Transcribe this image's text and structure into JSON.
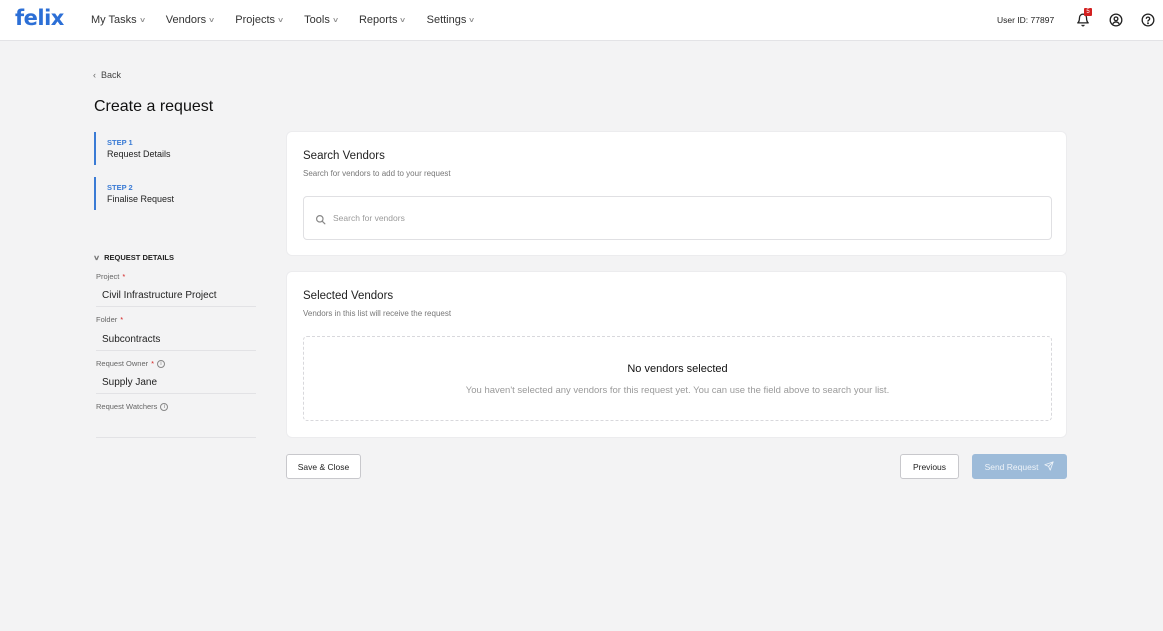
{
  "app": {
    "logo": "felix"
  },
  "nav": {
    "items": [
      {
        "label": "My Tasks"
      },
      {
        "label": "Vendors"
      },
      {
        "label": "Projects"
      },
      {
        "label": "Tools"
      },
      {
        "label": "Reports"
      },
      {
        "label": "Settings"
      }
    ],
    "user_id": "User ID: 77897",
    "notification_count": "5",
    "icons": [
      "bell-icon",
      "user-icon",
      "help-icon"
    ]
  },
  "page": {
    "back_label": "Back",
    "title": "Create a request"
  },
  "steps": [
    {
      "step": "STEP 1",
      "name": "Request Details"
    },
    {
      "step": "STEP 2",
      "name": "Finalise Request"
    }
  ],
  "request_details": {
    "heading": "REQUEST DETAILS",
    "project_label": "Project",
    "project_value": "Civil Infrastructure Project",
    "folder_label": "Folder",
    "folder_value": "Subcontracts",
    "owner_label": "Request Owner",
    "owner_value": "Supply Jane",
    "watchers_label": "Request Watchers",
    "required_mark": "*"
  },
  "search_vendors": {
    "title": "Search Vendors",
    "subtitle": "Search for vendors to add to your request",
    "placeholder": "Search for vendors"
  },
  "selected_vendors": {
    "title": "Selected Vendors",
    "subtitle": "Vendors in this list will receive the request",
    "empty_title": "No vendors selected",
    "empty_text": "You haven't selected any vendors for this request yet. You can use the field above to search your list."
  },
  "actions": {
    "save_close": "Save & Close",
    "previous": "Previous",
    "send_request": "Send Request"
  },
  "colors": {
    "accent": "#3a7bd5",
    "logo": "#2c6fd6",
    "send_disabled": "#9dbbd9",
    "badge": "#d32020"
  }
}
